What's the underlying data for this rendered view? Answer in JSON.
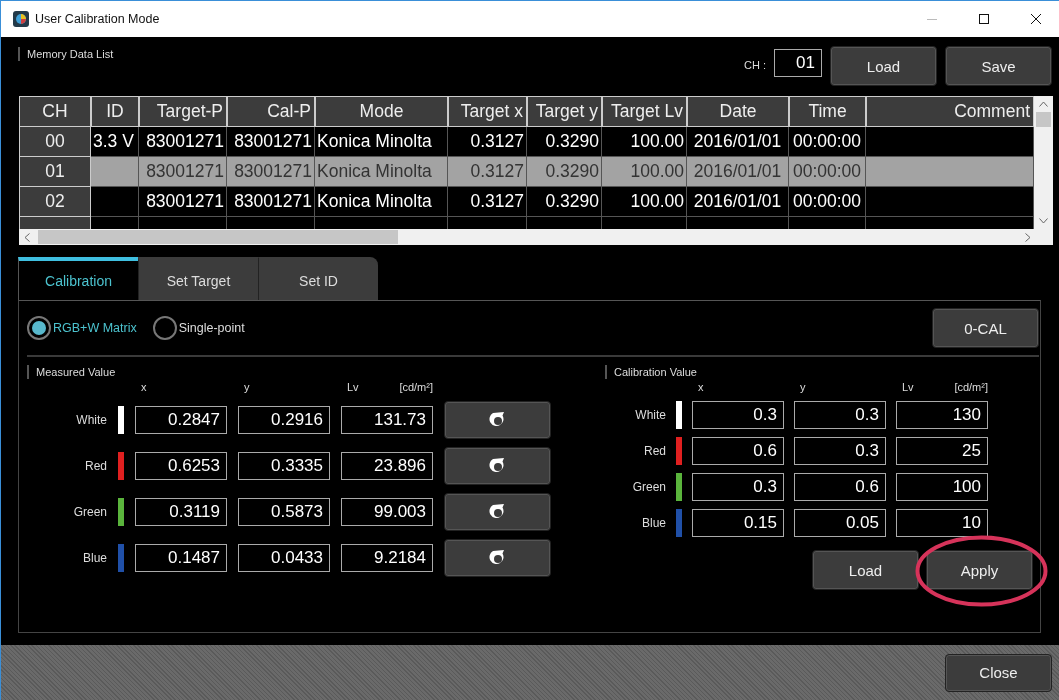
{
  "window": {
    "title": "User Calibration Mode"
  },
  "memory": {
    "title": "Memory Data List",
    "ch_label": "CH :",
    "ch_value": "01",
    "buttons": [
      "Load",
      "Save"
    ]
  },
  "table": {
    "columns": [
      "CH",
      "ID",
      "Target-P",
      "Cal-P",
      "Mode",
      "Target x",
      "Target y",
      "Target Lv",
      "Date",
      "Time",
      "Comment"
    ],
    "rows": [
      {
        "selected": false,
        "cells": [
          "00",
          "3.3 V",
          "83001271",
          "83001271",
          "Konica Minolta",
          "0.3127",
          "0.3290",
          "100.00",
          "2016/01/01",
          "00:00:00",
          ""
        ]
      },
      {
        "selected": true,
        "cells": [
          "01",
          "",
          "83001271",
          "83001271",
          "Konica Minolta",
          "0.3127",
          "0.3290",
          "100.00",
          "2016/01/01",
          "00:00:00",
          ""
        ]
      },
      {
        "selected": false,
        "cells": [
          "02",
          "",
          "83001271",
          "83001271",
          "Konica Minolta",
          "0.3127",
          "0.3290",
          "100.00",
          "2016/01/01",
          "00:00:00",
          ""
        ]
      }
    ]
  },
  "tabs": [
    {
      "label": "Calibration",
      "selected": true
    },
    {
      "label": "Set Target",
      "selected": false
    },
    {
      "label": "Set ID",
      "selected": false
    }
  ],
  "modes": [
    {
      "label": "RGB+W Matrix",
      "selected": true
    },
    {
      "label": "Single-point",
      "selected": false
    }
  ],
  "zero_cal": "0-CAL",
  "measured": {
    "title": "Measured Value",
    "headers": [
      "x",
      "y",
      "Lv",
      "[cd/m²]"
    ],
    "rows": [
      {
        "label": "White",
        "color": "#ffffff",
        "values": [
          "0.2847",
          "0.2916",
          "131.73"
        ]
      },
      {
        "label": "Red",
        "color": "#e02020",
        "values": [
          "0.6253",
          "0.3335",
          "23.896"
        ]
      },
      {
        "label": "Green",
        "color": "#5ab43c",
        "values": [
          "0.3119",
          "0.5873",
          "99.003"
        ]
      },
      {
        "label": "Blue",
        "color": "#2050a8",
        "values": [
          "0.1487",
          "0.0433",
          "9.2184"
        ]
      }
    ]
  },
  "calibration": {
    "title": "Calibration Value",
    "headers": [
      "x",
      "y",
      "Lv",
      "[cd/m²]"
    ],
    "rows": [
      {
        "label": "White",
        "color": "#ffffff",
        "values": [
          "0.3",
          "0.3",
          "130"
        ]
      },
      {
        "label": "Red",
        "color": "#e02020",
        "values": [
          "0.6",
          "0.3",
          "25"
        ]
      },
      {
        "label": "Green",
        "color": "#5ab43c",
        "values": [
          "0.3",
          "0.6",
          "100"
        ]
      },
      {
        "label": "Blue",
        "color": "#2050a8",
        "values": [
          "0.15",
          "0.05",
          "10"
        ]
      }
    ],
    "buttons": [
      {
        "label": "Load",
        "circled": false
      },
      {
        "label": "Apply",
        "circled": true
      }
    ]
  },
  "close": "Close"
}
